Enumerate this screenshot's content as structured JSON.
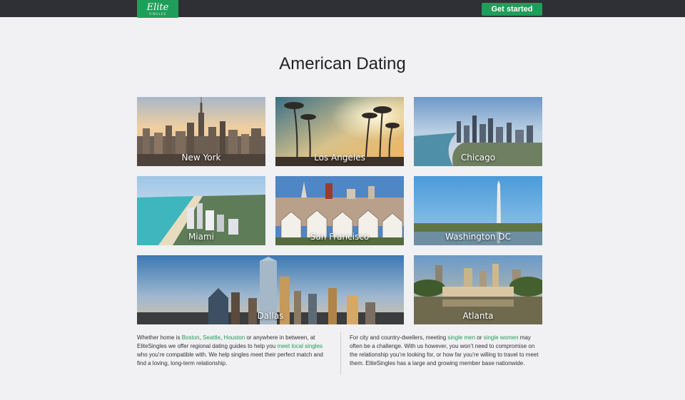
{
  "header": {
    "logo_text": "Elite",
    "logo_subtext": "SINGLES",
    "cta_label": "Get started"
  },
  "main": {
    "title": "American Dating",
    "cities": [
      {
        "label": "New York"
      },
      {
        "label": "Los Angeles"
      },
      {
        "label": "Chicago"
      },
      {
        "label": "Miami"
      },
      {
        "label": "San Francisco"
      },
      {
        "label": "Washington DC"
      },
      {
        "label": "Dallas"
      },
      {
        "label": "Atlanta"
      }
    ]
  },
  "text_left": {
    "p1": "Whether home is ",
    "link_boston": "Boston",
    "sep1": ", ",
    "link_seattle": "Seattle",
    "sep2": ", ",
    "link_houston": "Houston",
    "p2": " or anywhere in between, at EliteSingles we offer regional dating guides to help you ",
    "link_local": "meet local singles",
    "p3": " who you’re compatible with. We help singles meet their perfect match and find a loving, long-term relationship."
  },
  "text_right": {
    "p1": "For city and country-dwellers, meeting ",
    "link_men": "single men",
    "p2": " or ",
    "link_women": "single women",
    "p3": " may often be a challenge. With us however, you won’t need to compromise on the relationship you’re looking for, or how far you’re willing to travel to meet them. EliteSingles has a large and growing member base nationwide."
  },
  "colors": {
    "brand_green": "#1f9e5a",
    "topbar": "#2f3035",
    "background": "#f1f0f2"
  }
}
